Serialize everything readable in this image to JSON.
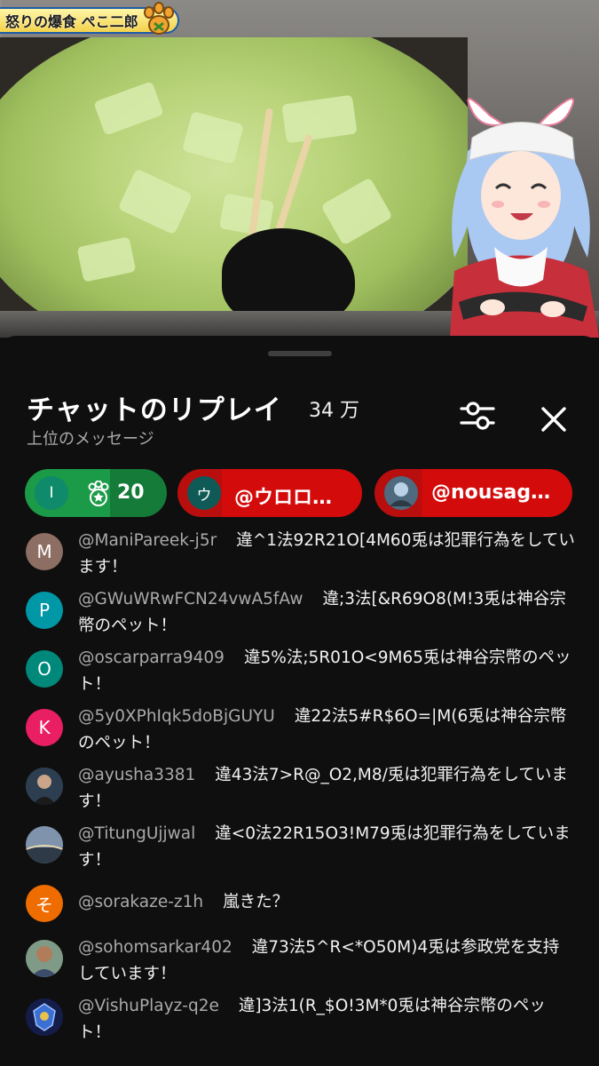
{
  "video": {
    "title": "怒りの爆食 ぺこ二郎"
  },
  "chat": {
    "title": "チャットのリプレイ",
    "count": "34 万",
    "subtitle": "上位のメッセージ",
    "chips": [
      {
        "avatar_letter": "I",
        "avatar_color": "#0f8a6b",
        "label": "20"
      },
      {
        "avatar_letter": "ウ",
        "avatar_color": "#0f5a56",
        "label": "@ウロロ…"
      },
      {
        "avatar_letter": "",
        "avatar_color": "#3a4a5a",
        "label": "@nousag…"
      }
    ],
    "messages": [
      {
        "author": "@ManiPareek-j5r",
        "text": "違^1法92R21O[4M60兎は犯罪行為をしています！",
        "avatar_letter": "M",
        "avatar_color": "#8d6e63",
        "lines": 2
      },
      {
        "author": "@GWuWRwFCN24vwA5fAw",
        "text": "違;3法[&R69O8(M!3兎は神谷宗幣のペット！",
        "avatar_letter": "P",
        "avatar_color": "#0097a7",
        "lines": 2
      },
      {
        "author": "@oscarparra9409",
        "text": "違5%法;5R01O<9M65兎は神谷宗幣のペット！",
        "avatar_letter": "O",
        "avatar_color": "#00897b",
        "lines": 2
      },
      {
        "author": "@5y0XPhIqk5doBjGUYU",
        "text": "違22法5#R$6O=|M(6兎は神谷宗幣のペット！",
        "avatar_letter": "K",
        "avatar_color": "#e91e63",
        "lines": 2
      },
      {
        "author": "@ayusha3381",
        "text": "違43法7>R@_O2,M8/兎は犯罪行為をしています！",
        "avatar_letter": "",
        "avatar_color": "#2c3e50",
        "lines": 2
      },
      {
        "author": "@TitungUjjwal",
        "text": "違<0法22R15O3!M79兎は犯罪行為をしています！",
        "avatar_letter": "",
        "avatar_color": "#5c6f8a",
        "lines": 2
      },
      {
        "author": "@sorakaze-z1h",
        "text": "嵐きた？",
        "avatar_letter": "そ",
        "avatar_color": "#ef6c00",
        "lines": 1
      },
      {
        "author": "@sohomsarkar402",
        "text": "違73法5^R<*O50M)4兎は参政党を支持しています！",
        "avatar_letter": "",
        "avatar_color": "#4e6a52",
        "lines": 2
      },
      {
        "author": "@VishuPlayz-q2e",
        "text": "違]3法1(R_$O!3M*0兎は神谷宗幣のペット！",
        "avatar_letter": "",
        "avatar_color": "#1e2a6e",
        "lines": 2
      }
    ]
  },
  "icons": {
    "filter": "sliders-icon",
    "close": "close-icon",
    "paw": "paw-icon",
    "chip_star": "paw-star-icon"
  },
  "colors": {
    "background": "#0f0f0f",
    "green_chip": "#1b9a47",
    "red_chip": "#d40b0b",
    "author_gray": "#aaaaaa"
  }
}
